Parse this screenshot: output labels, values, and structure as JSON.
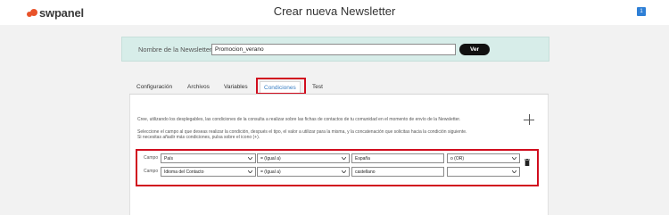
{
  "header": {
    "logo_text": "swpanel",
    "title": "Crear nueva Newsletter",
    "user_badge": "1",
    "brand_color": "#e8532a"
  },
  "name_panel": {
    "label": "Nombre de la Newsletter",
    "value": "Promocion_verano",
    "button_label": "Ver"
  },
  "tabs": [
    {
      "label": "Configuración",
      "active": false
    },
    {
      "label": "Archivos",
      "active": false
    },
    {
      "label": "Variables",
      "active": false
    },
    {
      "label": "Condiciones",
      "active": true
    },
    {
      "label": "Test",
      "active": false
    }
  ],
  "conditions": {
    "intro": "Cree, utilizando los desplegables, las condiciones de la consulta a realizar sobre las fichas de contactos de tu comunidad en el momento de envío de la Newsletter.",
    "help_line_1": "Seleccione el campo al que deseas realizar la condición, después el tipo,  el valor a utilizar para la misma, y la concatenación que solicitas hacia la condición siguiente.",
    "help_line_2": "Si necesitas añadir más condiciones, pulsa sobre el icono (+).",
    "rows": [
      {
        "label": "Campo",
        "field": "País",
        "operator": "= (Igual a)",
        "value": "España",
        "concat": "o (OR)"
      },
      {
        "label": "Campo",
        "field": "Idioma del Contacto",
        "operator": "= (Igual a)",
        "value": "castellano",
        "concat": ""
      }
    ]
  },
  "highlight_color": "#d10d1e",
  "icons": [
    "plus-icon",
    "trash-icon",
    "chevron-down-icon"
  ]
}
